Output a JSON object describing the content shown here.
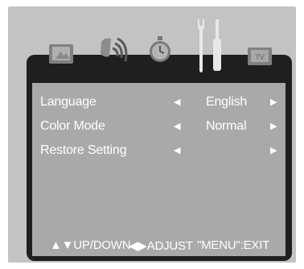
{
  "icons": [
    {
      "name": "picture-icon"
    },
    {
      "name": "sound-icon"
    },
    {
      "name": "clock-icon"
    },
    {
      "name": "tools-icon"
    },
    {
      "name": "tv-icon"
    }
  ],
  "menu": {
    "rows": [
      {
        "label": "Language",
        "value": "English",
        "left_arrow": "◀",
        "right_arrow": "▶"
      },
      {
        "label": "Color Mode",
        "value": "Normal",
        "left_arrow": "◀",
        "right_arrow": "▶"
      },
      {
        "label": "Restore Setting",
        "value": "",
        "left_arrow": "◀",
        "right_arrow": "▶"
      }
    ]
  },
  "footer": {
    "updown": "▲▼UP/DOWN",
    "adjust": "◀▶ADJUST",
    "exit": "\"MENU\":EXIT"
  },
  "colors": {
    "frame": "#c3c3c3",
    "panel_dark": "#1f1f1f",
    "menu_bg": "#a9a9a9",
    "text": "#ffffff"
  }
}
